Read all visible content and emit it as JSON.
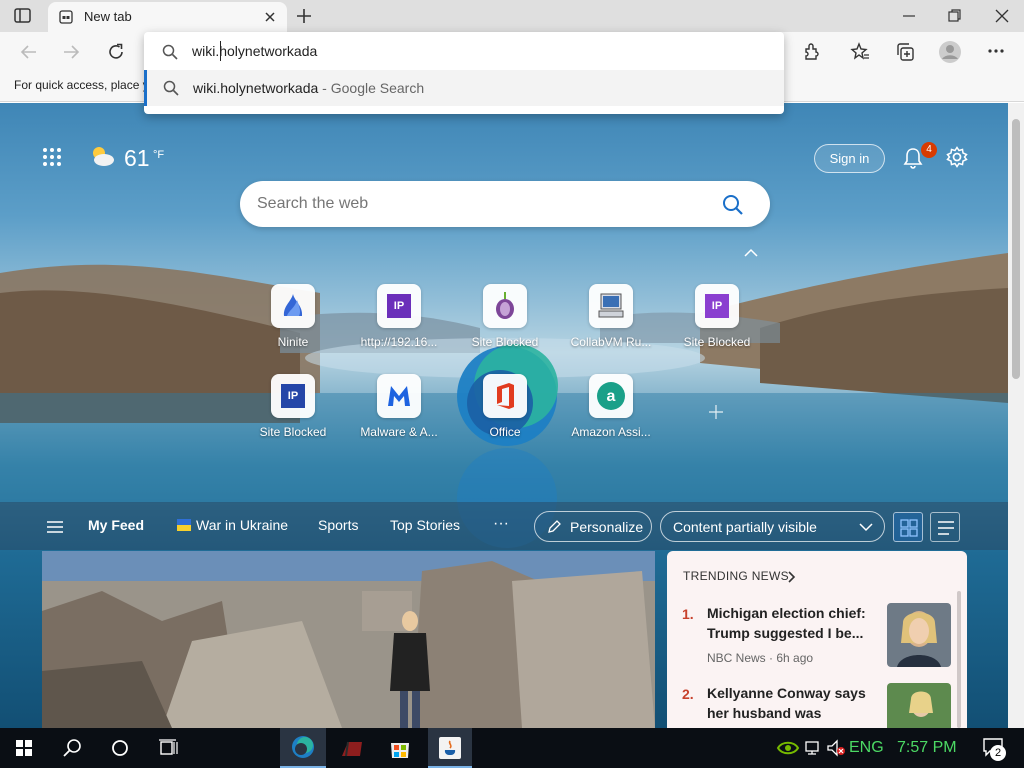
{
  "browser": {
    "tab_title": "New tab",
    "favorites_bar_text": "For quick access, place y",
    "address_input": "wiki.holynetworkada",
    "suggestion": {
      "query": "wiki.holynetworkada",
      "suffix": " - Google Search"
    }
  },
  "newtab": {
    "weather": {
      "temp": "61",
      "unit": "°F",
      "icon": "partly-cloudy-icon"
    },
    "sign_in_label": "Sign in",
    "notification_count": "4",
    "search_placeholder": "Search the web",
    "tiles": [
      {
        "label": "Ninite",
        "icon": "ninite-icon"
      },
      {
        "label": "http://192.16...",
        "icon": "ip-icon",
        "badge": "IP"
      },
      {
        "label": "Site Blocked",
        "icon": "tor-icon"
      },
      {
        "label": "CollabVM Ru...",
        "icon": "computer-icon"
      },
      {
        "label": "Site Blocked",
        "icon": "ip-icon",
        "badge": "IP"
      },
      {
        "label": "Site Blocked",
        "icon": "ip-icon",
        "badge": "IP"
      },
      {
        "label": "Malware & A...",
        "icon": "malwarebytes-icon"
      },
      {
        "label": "Office",
        "icon": "office-icon"
      },
      {
        "label": "Amazon Assi...",
        "icon": "amazon-assistant-icon"
      }
    ],
    "feed": {
      "links": [
        "My Feed",
        "War in Ukraine",
        "Sports",
        "Top Stories"
      ],
      "more": "···",
      "personalize_label": "Personalize",
      "content_visibility": "Content partially visible"
    },
    "trending": {
      "title": "TRENDING NEWS",
      "items": [
        {
          "num": "1.",
          "headline": "Michigan election chief: Trump suggested I be...",
          "source": "NBC News · 6h ago"
        },
        {
          "num": "2.",
          "headline": "Kellyanne Conway says her husband was 'cheating b...",
          "source": ""
        }
      ]
    }
  },
  "taskbar": {
    "language": "ENG",
    "time": "7:57 PM",
    "notifications": "2"
  },
  "colors": {
    "accent": "#1a6fc9",
    "tile_purple": "#6b2fba",
    "trending_num": "#c8412c",
    "clock": "#4cd964"
  }
}
